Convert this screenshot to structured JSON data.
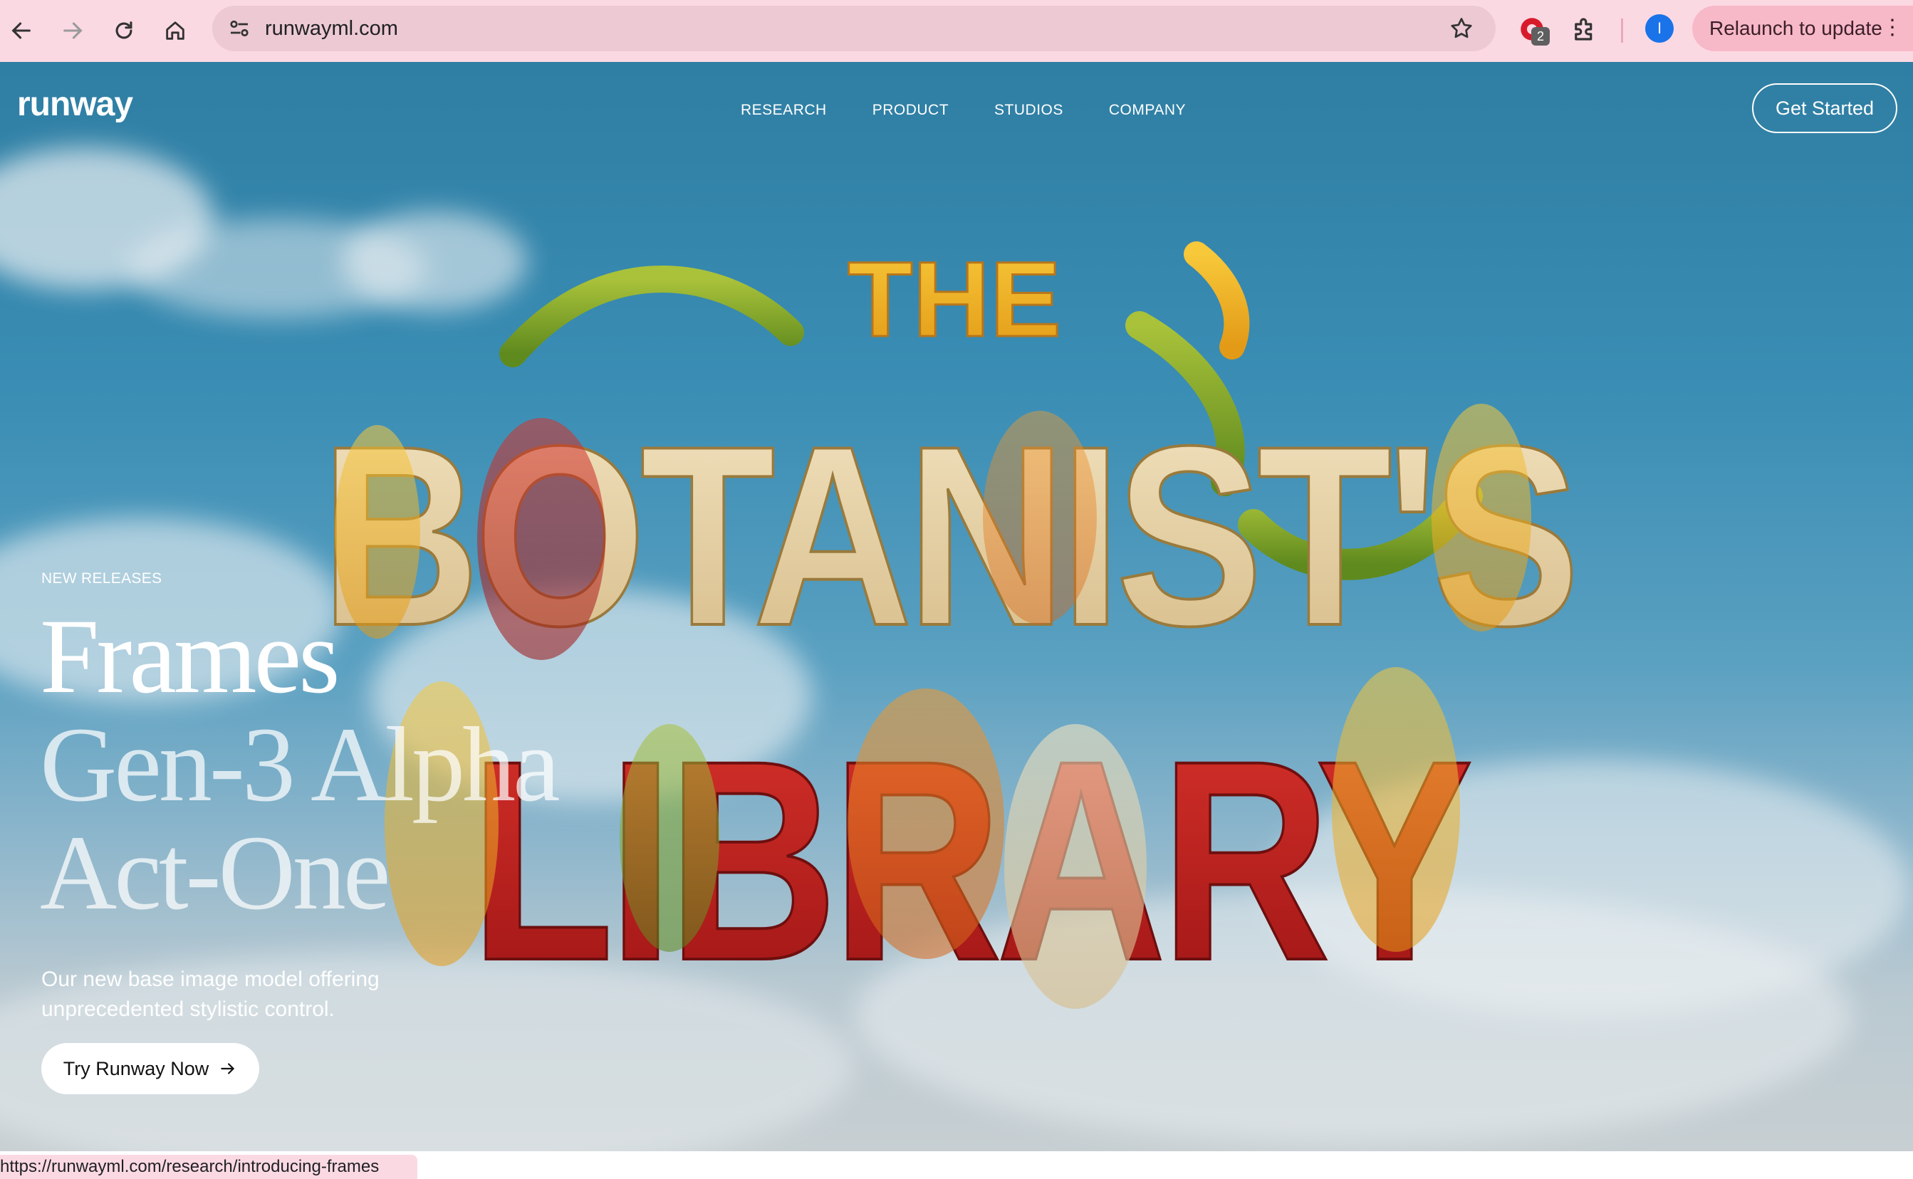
{
  "browser": {
    "back_icon": "arrow-left-icon",
    "forward_icon": "arrow-right-icon",
    "reload_icon": "reload-icon",
    "home_icon": "home-icon",
    "url": "runwayml.com",
    "extension_badge": "2",
    "profile_initial": "I",
    "relaunch_label": "Relaunch to update",
    "accent": "#fbd9e3"
  },
  "site": {
    "logo": "runway",
    "nav": [
      "RESEARCH",
      "PRODUCT",
      "STUDIOS",
      "COMPANY"
    ],
    "cta_label": "Get Started"
  },
  "hero": {
    "eyebrow": "NEW RELEASES",
    "headlines": [
      "Frames",
      "Gen-3 Alpha",
      "Act-One"
    ],
    "description": "Our new base image model offering unprecedented stylistic control.",
    "button_label": "Try Runway Now",
    "artwork_text": {
      "line1": "THE",
      "line2": "BOTANIST'S",
      "line3": "LIBRARY"
    }
  },
  "status_bar": {
    "link": "https://runwayml.com/research/introducing-frames"
  }
}
